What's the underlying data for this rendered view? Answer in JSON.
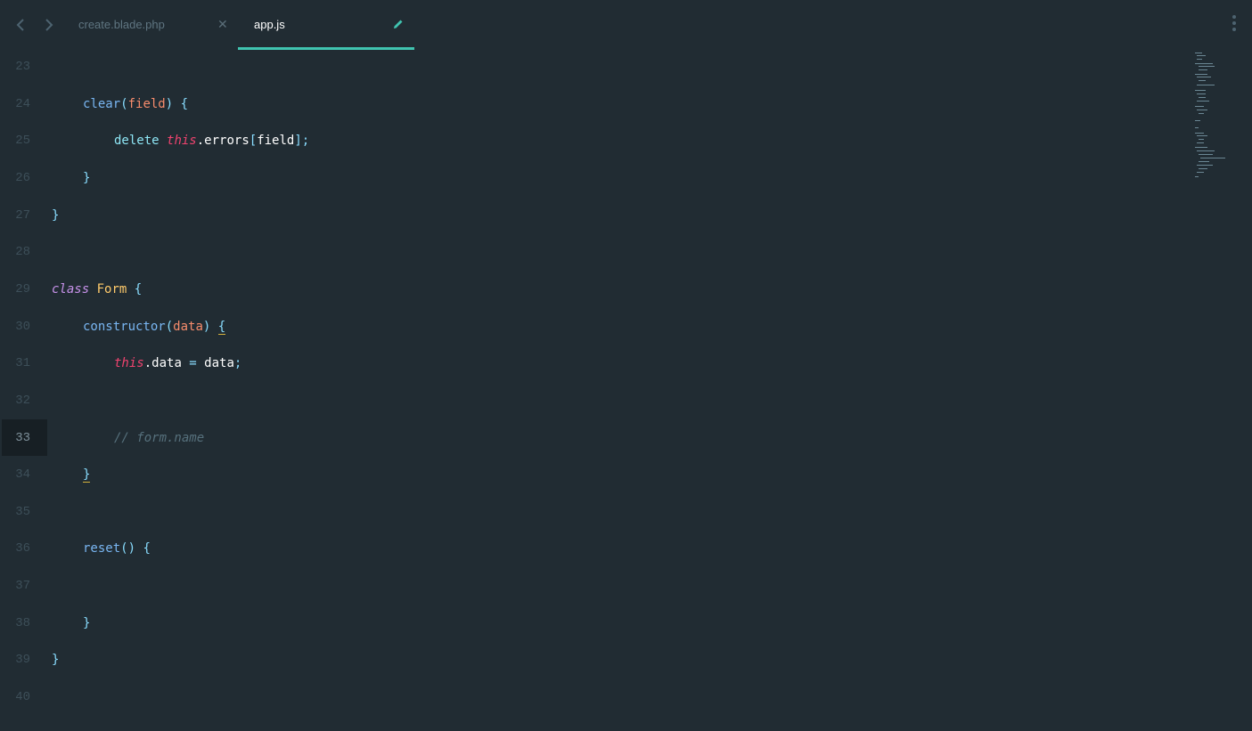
{
  "tabs": [
    {
      "label": "create.blade.php",
      "active": false
    },
    {
      "label": "app.js",
      "active": true
    }
  ],
  "icons": {
    "back": "chevron-left-icon",
    "forward": "chevron-right-icon",
    "close": "close-icon",
    "modified": "pencil-icon",
    "menu": "more-vertical-icon"
  },
  "colors": {
    "background": "#212c33",
    "accent": "#40c4b0",
    "this_keyword": "#f0436f",
    "class_name": "#ffcb6b",
    "parameter": "#f78c6c"
  },
  "editor": {
    "current_line": 33,
    "lines": [
      {
        "number": "23",
        "tokens": []
      },
      {
        "number": "24",
        "tokens": [
          {
            "t": "clear",
            "c": "kw-blue"
          },
          {
            "t": "(",
            "c": "punct"
          },
          {
            "t": "field",
            "c": "param"
          },
          {
            "t": ")",
            "c": "punct"
          },
          {
            "t": " ",
            "c": "plain"
          },
          {
            "t": "{",
            "c": "punct"
          }
        ]
      },
      {
        "number": "25",
        "tokens": [
          {
            "t": "delete",
            "c": "kw-cyan"
          },
          {
            "t": " ",
            "c": "plain"
          },
          {
            "t": "this",
            "c": "this-kw"
          },
          {
            "t": ".",
            "c": "plain"
          },
          {
            "t": "errors",
            "c": "plain"
          },
          {
            "t": "[",
            "c": "punct"
          },
          {
            "t": "field",
            "c": "plain"
          },
          {
            "t": "];",
            "c": "punct"
          }
        ]
      },
      {
        "number": "26",
        "tokens": [
          {
            "t": "}",
            "c": "punct"
          }
        ]
      },
      {
        "number": "27",
        "tokens": [
          {
            "t": "}",
            "c": "punct"
          }
        ]
      },
      {
        "number": "28",
        "tokens": []
      },
      {
        "number": "29",
        "tokens": [
          {
            "t": "class",
            "c": "class-kw"
          },
          {
            "t": " ",
            "c": "plain"
          },
          {
            "t": "Form",
            "c": "class-name"
          },
          {
            "t": " ",
            "c": "plain"
          },
          {
            "t": "{",
            "c": "punct"
          }
        ]
      },
      {
        "number": "30",
        "tokens": [
          {
            "t": "constructor",
            "c": "kw-blue"
          },
          {
            "t": "(",
            "c": "punct"
          },
          {
            "t": "data",
            "c": "param"
          },
          {
            "t": ")",
            "c": "punct"
          },
          {
            "t": " ",
            "c": "plain"
          },
          {
            "t": "{",
            "c": "punct bracket-match"
          }
        ]
      },
      {
        "number": "31",
        "tokens": [
          {
            "t": "this",
            "c": "this-kw"
          },
          {
            "t": ".",
            "c": "plain"
          },
          {
            "t": "data",
            "c": "plain"
          },
          {
            "t": " = ",
            "c": "punct"
          },
          {
            "t": "data",
            "c": "plain"
          },
          {
            "t": ";",
            "c": "punct"
          }
        ]
      },
      {
        "number": "32",
        "tokens": []
      },
      {
        "number": "33",
        "tokens": [
          {
            "t": "// form.name",
            "c": "comment"
          }
        ]
      },
      {
        "number": "34",
        "tokens": [
          {
            "t": "}",
            "c": "punct bracket-match"
          }
        ]
      },
      {
        "number": "35",
        "tokens": []
      },
      {
        "number": "36",
        "tokens": [
          {
            "t": "reset",
            "c": "kw-blue"
          },
          {
            "t": "()",
            "c": "punct"
          },
          {
            "t": " ",
            "c": "plain"
          },
          {
            "t": "{",
            "c": "punct"
          }
        ]
      },
      {
        "number": "37",
        "tokens": []
      },
      {
        "number": "38",
        "tokens": [
          {
            "t": "}",
            "c": "punct"
          }
        ]
      },
      {
        "number": "39",
        "tokens": [
          {
            "t": "}",
            "c": "punct"
          }
        ]
      },
      {
        "number": "40",
        "tokens": []
      }
    ]
  }
}
